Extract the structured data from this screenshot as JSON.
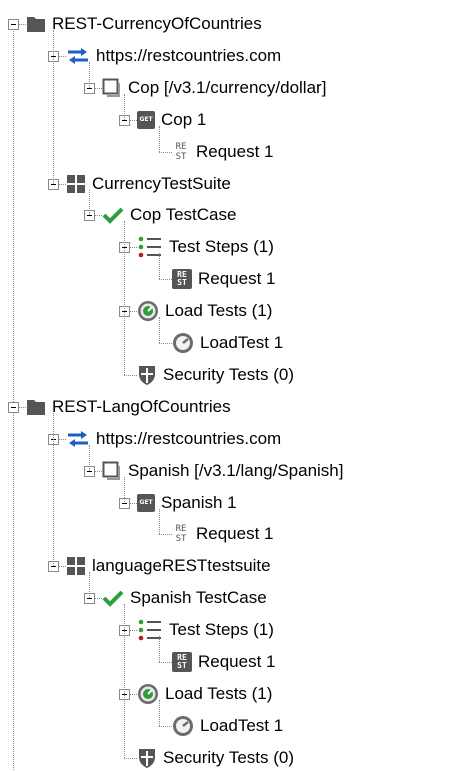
{
  "tree": {
    "projects": [
      {
        "name": "REST-CurrencyOfCountries",
        "service": "https://restcountries.com",
        "resource": "Cop [/v3.1/currency/dollar]",
        "method_badge": "GET",
        "method": "Cop 1",
        "request_badge": [
          "RE",
          "ST"
        ],
        "request": "Request 1",
        "suite": "CurrencyTestSuite",
        "testcase": "Cop TestCase",
        "test_steps": "Test Steps (1)",
        "step_request_badge": [
          "RE",
          "ST"
        ],
        "step_request": "Request 1",
        "load_tests": "Load Tests (1)",
        "load_test": "LoadTest 1",
        "security_tests": "Security Tests (0)"
      },
      {
        "name": "REST-LangOfCountries",
        "service": "https://restcountries.com",
        "resource": "Spanish [/v3.1/lang/Spanish]",
        "method_badge": "GET",
        "method": "Spanish 1",
        "request_badge": [
          "RE",
          "ST"
        ],
        "request": "Request 1",
        "suite": "languageRESTtestsuite",
        "testcase": "Spanish TestCase",
        "test_steps": "Test Steps (1)",
        "step_request_badge": [
          "RE",
          "ST"
        ],
        "step_request": "Request 1",
        "load_tests": "Load Tests (1)",
        "load_test": "LoadTest 1",
        "security_tests": "Security Tests (0)"
      }
    ],
    "icons": {
      "project": "folder-icon",
      "service": "interface-arrows-icon",
      "resource": "resource-window-icon",
      "method": "get-method-icon",
      "request": "rest-request-icon",
      "suite": "test-suite-grid-icon",
      "testcase": "checkmark-icon",
      "test_steps": "test-steps-list-icon",
      "load_tests": "load-test-gauge-icon",
      "security_tests": "security-shield-icon"
    },
    "colors": {
      "arrows": "#1f5fbf",
      "check": "#2e9e3a",
      "gauge": "#2e9e3a",
      "badge": "#555555"
    }
  }
}
